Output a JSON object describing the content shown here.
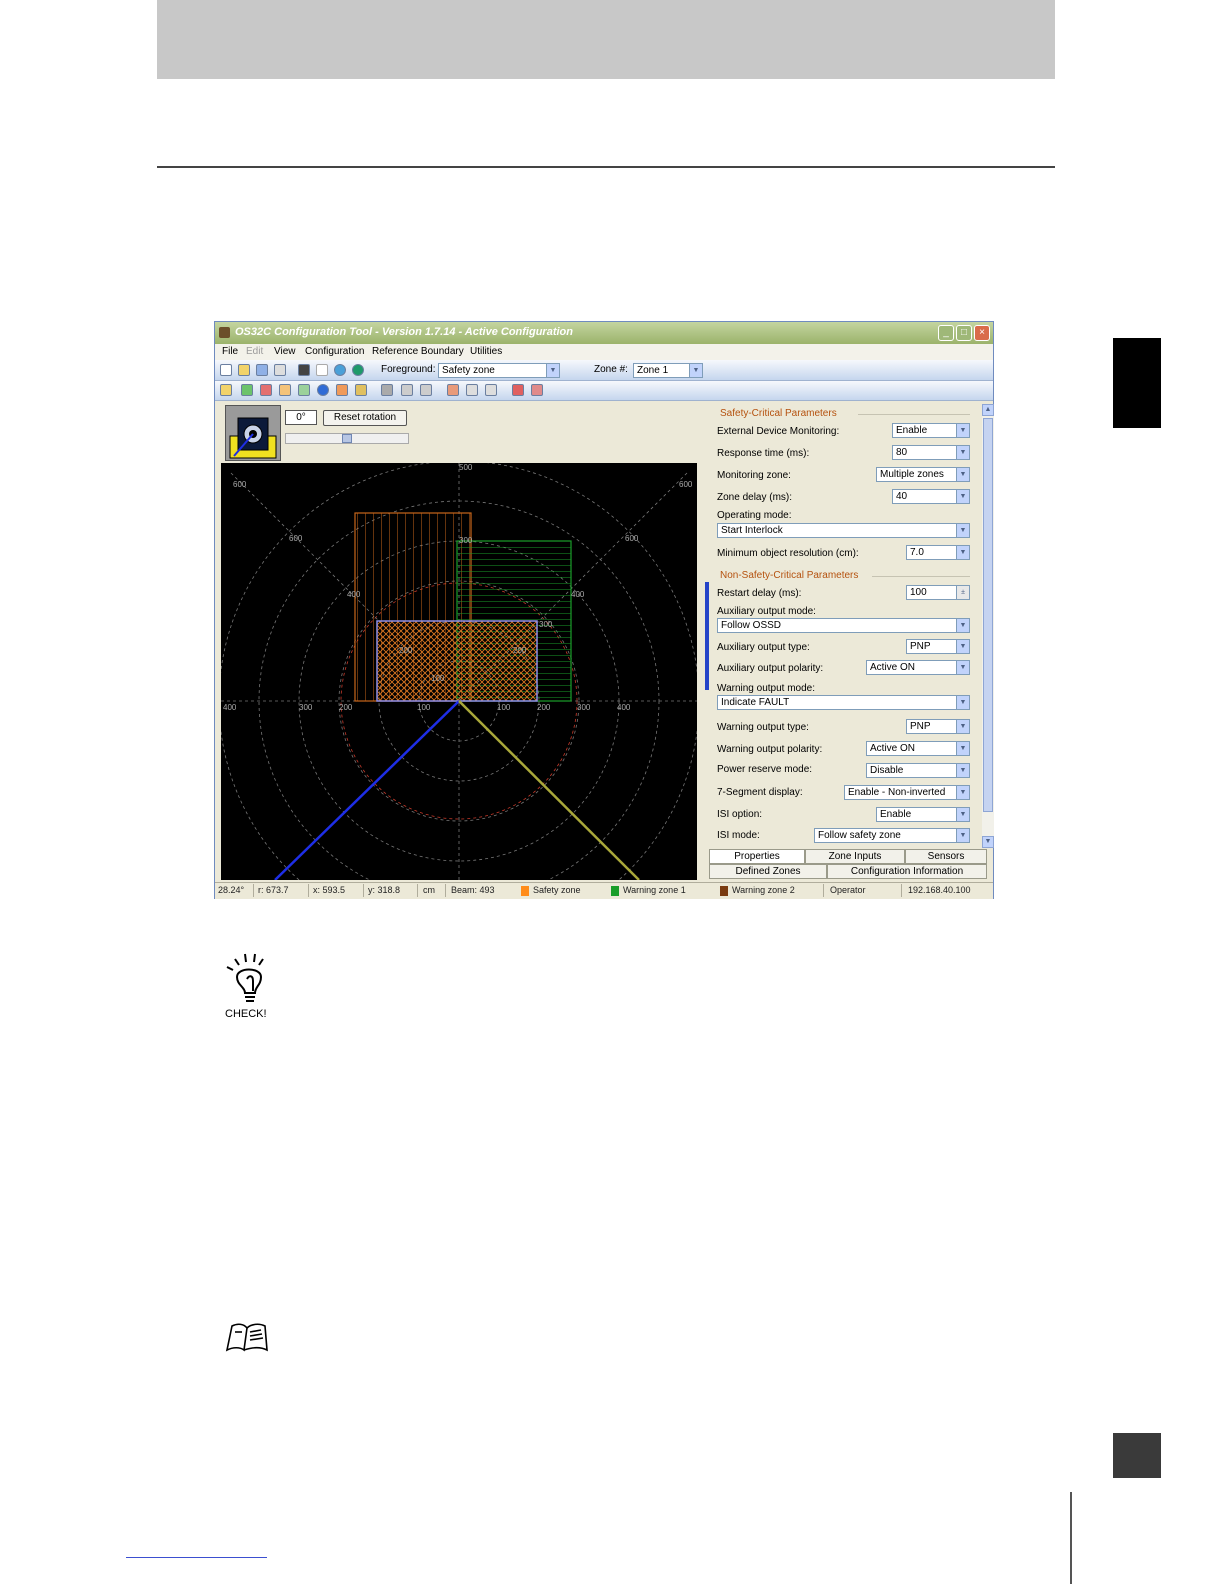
{
  "window": {
    "title": "OS32C Configuration Tool - Version 1.7.14 - Active Configuration",
    "minimize_glyph": "_",
    "maximize_glyph": "□",
    "close_glyph": "×"
  },
  "menu": [
    "File",
    "Edit",
    "View",
    "Configuration",
    "Reference Boundary",
    "Utilities"
  ],
  "toolbar": {
    "foreground_label": "Foreground:",
    "foreground_value": "Safety zone",
    "zone_label": "Zone #:",
    "zone_value": "Zone 1"
  },
  "view": {
    "rotation_value": "0°",
    "reset_rotation": "Reset rotation",
    "radial_labels": [
      "500",
      "600",
      "600",
      "600",
      "600",
      "400",
      "400",
      "300",
      "300",
      "200",
      "200",
      "100"
    ],
    "axis_labels": [
      "400",
      "300",
      "200",
      "100",
      "100",
      "200",
      "300",
      "400"
    ]
  },
  "properties": {
    "safety_critical": {
      "title": "Safety-Critical Parameters",
      "items": [
        {
          "label": "External Device Monitoring:",
          "value": "Enable"
        },
        {
          "label": "Response time (ms):",
          "value": "80"
        },
        {
          "label": "Monitoring zone:",
          "value": "Multiple zones"
        },
        {
          "label": "Zone delay (ms):",
          "value": "40"
        },
        {
          "label": "Operating mode:",
          "value": "Start Interlock"
        },
        {
          "label": "Minimum object resolution (cm):",
          "value": "7.0"
        }
      ]
    },
    "non_safety_critical": {
      "title": "Non-Safety-Critical Parameters",
      "items": [
        {
          "label": "Restart delay (ms):",
          "value": "100"
        },
        {
          "label": "Auxiliary output mode:",
          "value": "Follow OSSD"
        },
        {
          "label": "Auxiliary output type:",
          "value": "PNP"
        },
        {
          "label": "Auxiliary output polarity:",
          "value": "Active ON"
        },
        {
          "label": "Warning output mode:",
          "value": "Indicate FAULT"
        },
        {
          "label": "Warning output type:",
          "value": "PNP"
        },
        {
          "label": "Warning output polarity:",
          "value": "Active ON"
        },
        {
          "label": "Power reserve mode:",
          "value": "Disable"
        },
        {
          "label": "7-Segment display:",
          "value": "Enable - Non-inverted"
        },
        {
          "label": "ISI option:",
          "value": "Enable"
        },
        {
          "label": "ISI mode:",
          "value": "Follow safety zone"
        }
      ]
    }
  },
  "tabs": {
    "row1": [
      "Properties",
      "Zone Inputs",
      "Sensors"
    ],
    "row2": [
      "Defined Zones",
      "Configuration Information"
    ]
  },
  "status": {
    "angle": "28.24°",
    "r": "r: 673.7",
    "x": "x: 593.5",
    "y": "y: 318.8",
    "unit": "cm",
    "beam": "Beam: 493",
    "legend": [
      "Safety zone",
      "Warning zone 1",
      "Warning zone 2"
    ],
    "user": "Operator",
    "ip": "192.168.40.100"
  },
  "page": {
    "check_caption": "CHECK!"
  },
  "colors": {
    "safety_zone": "#ff8c1a",
    "warning_zone_1": "#1a9e2a",
    "warning_zone_2": "#7a3b10",
    "section_title": "#b5520f",
    "blue_ray": "#1e2ee6",
    "olive_ray": "#a9a83a"
  }
}
